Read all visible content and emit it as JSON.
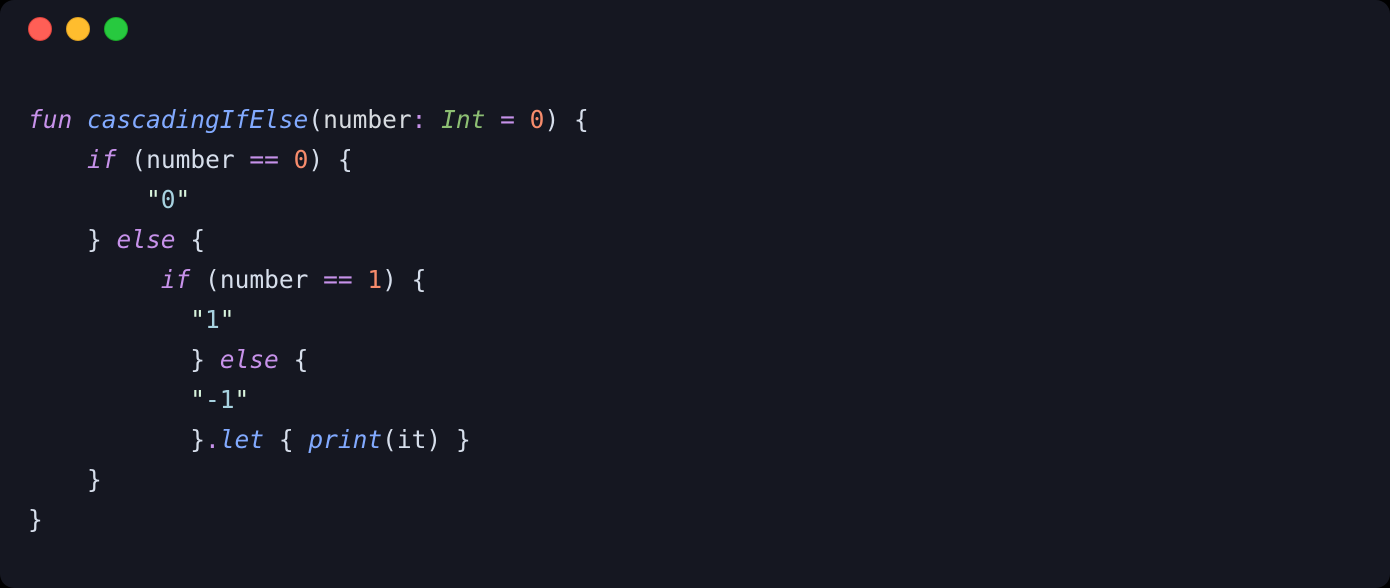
{
  "code": {
    "kw_fun": "fun",
    "fn_name": "cascadingIfElse",
    "param_name": "number",
    "type_int": "Int",
    "default_zero": "0",
    "kw_if": "if",
    "kw_else": "else",
    "eqeq": "==",
    "lit_zero": "0",
    "lit_one": "1",
    "str_zero": "0",
    "str_one": "1",
    "str_neg1": "-1",
    "let_name": "let",
    "print_name": "print",
    "it_name": "it"
  }
}
